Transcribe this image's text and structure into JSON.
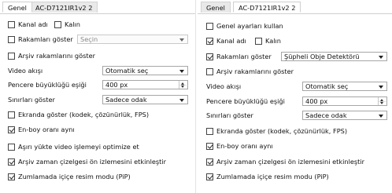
{
  "left": {
    "tabs": [
      "Genel",
      "AC-D7121IR1v2 2"
    ],
    "kanal_adi": {
      "label": "Kanal adı",
      "checked": true
    },
    "kalin": {
      "label": "Kalın",
      "checked": false
    },
    "rakamlari_goster": {
      "label": "Rakamları göster",
      "checked": false,
      "select_value": "Seçin"
    },
    "arsiv_rakamlari": {
      "label": "Arşiv rakamlarını göster",
      "checked": false
    },
    "video_akisi": {
      "label": "Video akışı",
      "value": "Otomatik seç"
    },
    "pencere_esigi": {
      "label": "Pencere büyüklüğü eşiği",
      "value": "400 px"
    },
    "sinirlari_goster": {
      "label": "Sınırları göster",
      "value": "Sadece odak"
    },
    "ekranda_goster": {
      "label": "Ekranda göster (kodek, çözünürlük, FPS)",
      "checked": false
    },
    "en_boy": {
      "label": "En-boy oranı aynı",
      "checked": true
    },
    "asiri_yukte": {
      "label": "Aşırı yükte video işlemeyi optimize et",
      "checked": false
    },
    "arsiv_zaman": {
      "label": "Arşiv zaman çizelgesi ön izlemesini etkinleştir",
      "checked": true
    },
    "zumlamada": {
      "label": "Zumlamada içiçe resim modu (PiP)",
      "checked": true
    }
  },
  "right": {
    "tabs": [
      "Genel",
      "AC-D7121IR1v2 2"
    ],
    "genel_ayarlari": {
      "label": "Genel ayarları kullan",
      "checked": false
    },
    "kanal_adi": {
      "label": "Kanal adı",
      "checked": true
    },
    "kalin": {
      "label": "Kalın",
      "checked": false
    },
    "rakamlari_goster": {
      "label": "Rakamları göster",
      "checked": true,
      "select_value": "Şüpheli Obje Detektörü"
    },
    "arsiv_rakamlari": {
      "label": "Arşiv rakamlarını göster",
      "checked": false
    },
    "video_akisi": {
      "label": "Video akışı",
      "value": "Otomatik seç"
    },
    "pencere_esigi": {
      "label": "Pencere büyüklüğü eşiği",
      "value": "400 px"
    },
    "sinirlari_goster": {
      "label": "Sınırları göster",
      "value": "Sadece odak"
    },
    "ekranda_goster": {
      "label": "Ekranda göster (kodek, çözünürlük, FPS)",
      "checked": false
    },
    "en_boy": {
      "label": "En-boy oranı aynı",
      "checked": true
    },
    "arsiv_zaman": {
      "label": "Arşiv zaman çizelgesi ön izlemesini etkinleştir",
      "checked": true
    },
    "zumlamada": {
      "label": "Zumlamada içiçe resim modu (PiP)",
      "checked": true
    }
  },
  "icons": {
    "dropdown": "chevron-down-icon",
    "spinner": "spinner-arrows-icon",
    "check": "checkmark-icon"
  }
}
